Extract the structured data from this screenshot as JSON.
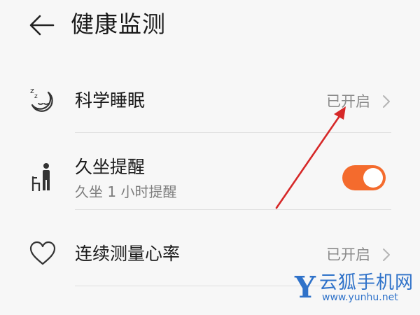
{
  "header": {
    "title": "健康监测",
    "back_icon": "arrow-left-icon"
  },
  "rows": [
    {
      "icon": "sleep-moon-icon",
      "label": "科学睡眠",
      "value": "已开启"
    },
    {
      "icon": "sedentary-person-icon",
      "label": "久坐提醒",
      "sublabel": "久坐 1 小时提醒",
      "toggle_on": true
    },
    {
      "icon": "heart-icon",
      "label": "连续测量心率",
      "value": "已开启"
    }
  ],
  "colors": {
    "background": "#f7f7f7",
    "toggle_active": "#f46b2d",
    "annotation_arrow": "#d62828",
    "watermark": "#2f72c9"
  },
  "watermark": {
    "letter": "Y",
    "name": "云狐手机网",
    "url": "www.yunhu.net"
  }
}
